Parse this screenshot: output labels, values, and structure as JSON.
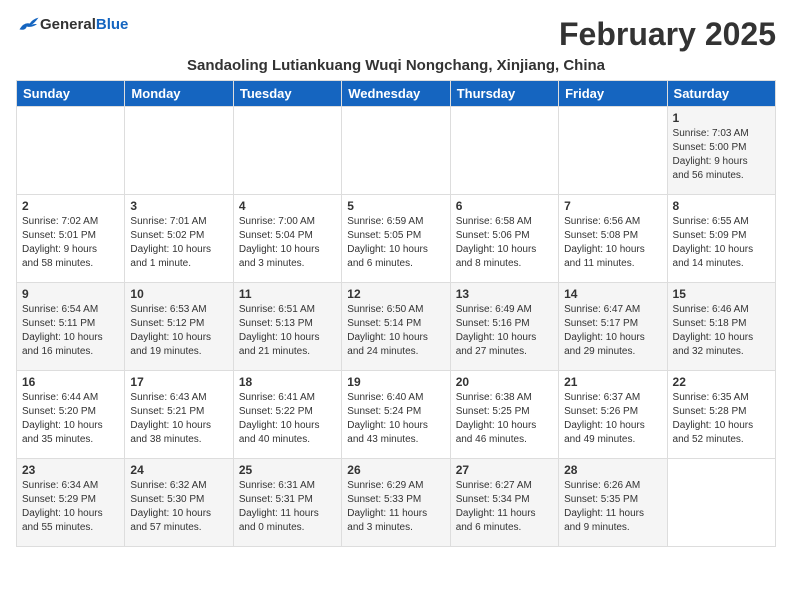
{
  "logo": {
    "general": "General",
    "blue": "Blue"
  },
  "title": "February 2025",
  "location": "Sandaoling Lutiankuang Wuqi Nongchang, Xinjiang, China",
  "weekdays": [
    "Sunday",
    "Monday",
    "Tuesday",
    "Wednesday",
    "Thursday",
    "Friday",
    "Saturday"
  ],
  "weeks": [
    [
      {
        "day": "",
        "info": ""
      },
      {
        "day": "",
        "info": ""
      },
      {
        "day": "",
        "info": ""
      },
      {
        "day": "",
        "info": ""
      },
      {
        "day": "",
        "info": ""
      },
      {
        "day": "",
        "info": ""
      },
      {
        "day": "1",
        "info": "Sunrise: 7:03 AM\nSunset: 5:00 PM\nDaylight: 9 hours\nand 56 minutes."
      }
    ],
    [
      {
        "day": "2",
        "info": "Sunrise: 7:02 AM\nSunset: 5:01 PM\nDaylight: 9 hours\nand 58 minutes."
      },
      {
        "day": "3",
        "info": "Sunrise: 7:01 AM\nSunset: 5:02 PM\nDaylight: 10 hours\nand 1 minute."
      },
      {
        "day": "4",
        "info": "Sunrise: 7:00 AM\nSunset: 5:04 PM\nDaylight: 10 hours\nand 3 minutes."
      },
      {
        "day": "5",
        "info": "Sunrise: 6:59 AM\nSunset: 5:05 PM\nDaylight: 10 hours\nand 6 minutes."
      },
      {
        "day": "6",
        "info": "Sunrise: 6:58 AM\nSunset: 5:06 PM\nDaylight: 10 hours\nand 8 minutes."
      },
      {
        "day": "7",
        "info": "Sunrise: 6:56 AM\nSunset: 5:08 PM\nDaylight: 10 hours\nand 11 minutes."
      },
      {
        "day": "8",
        "info": "Sunrise: 6:55 AM\nSunset: 5:09 PM\nDaylight: 10 hours\nand 14 minutes."
      }
    ],
    [
      {
        "day": "9",
        "info": "Sunrise: 6:54 AM\nSunset: 5:11 PM\nDaylight: 10 hours\nand 16 minutes."
      },
      {
        "day": "10",
        "info": "Sunrise: 6:53 AM\nSunset: 5:12 PM\nDaylight: 10 hours\nand 19 minutes."
      },
      {
        "day": "11",
        "info": "Sunrise: 6:51 AM\nSunset: 5:13 PM\nDaylight: 10 hours\nand 21 minutes."
      },
      {
        "day": "12",
        "info": "Sunrise: 6:50 AM\nSunset: 5:14 PM\nDaylight: 10 hours\nand 24 minutes."
      },
      {
        "day": "13",
        "info": "Sunrise: 6:49 AM\nSunset: 5:16 PM\nDaylight: 10 hours\nand 27 minutes."
      },
      {
        "day": "14",
        "info": "Sunrise: 6:47 AM\nSunset: 5:17 PM\nDaylight: 10 hours\nand 29 minutes."
      },
      {
        "day": "15",
        "info": "Sunrise: 6:46 AM\nSunset: 5:18 PM\nDaylight: 10 hours\nand 32 minutes."
      }
    ],
    [
      {
        "day": "16",
        "info": "Sunrise: 6:44 AM\nSunset: 5:20 PM\nDaylight: 10 hours\nand 35 minutes."
      },
      {
        "day": "17",
        "info": "Sunrise: 6:43 AM\nSunset: 5:21 PM\nDaylight: 10 hours\nand 38 minutes."
      },
      {
        "day": "18",
        "info": "Sunrise: 6:41 AM\nSunset: 5:22 PM\nDaylight: 10 hours\nand 40 minutes."
      },
      {
        "day": "19",
        "info": "Sunrise: 6:40 AM\nSunset: 5:24 PM\nDaylight: 10 hours\nand 43 minutes."
      },
      {
        "day": "20",
        "info": "Sunrise: 6:38 AM\nSunset: 5:25 PM\nDaylight: 10 hours\nand 46 minutes."
      },
      {
        "day": "21",
        "info": "Sunrise: 6:37 AM\nSunset: 5:26 PM\nDaylight: 10 hours\nand 49 minutes."
      },
      {
        "day": "22",
        "info": "Sunrise: 6:35 AM\nSunset: 5:28 PM\nDaylight: 10 hours\nand 52 minutes."
      }
    ],
    [
      {
        "day": "23",
        "info": "Sunrise: 6:34 AM\nSunset: 5:29 PM\nDaylight: 10 hours\nand 55 minutes."
      },
      {
        "day": "24",
        "info": "Sunrise: 6:32 AM\nSunset: 5:30 PM\nDaylight: 10 hours\nand 57 minutes."
      },
      {
        "day": "25",
        "info": "Sunrise: 6:31 AM\nSunset: 5:31 PM\nDaylight: 11 hours\nand 0 minutes."
      },
      {
        "day": "26",
        "info": "Sunrise: 6:29 AM\nSunset: 5:33 PM\nDaylight: 11 hours\nand 3 minutes."
      },
      {
        "day": "27",
        "info": "Sunrise: 6:27 AM\nSunset: 5:34 PM\nDaylight: 11 hours\nand 6 minutes."
      },
      {
        "day": "28",
        "info": "Sunrise: 6:26 AM\nSunset: 5:35 PM\nDaylight: 11 hours\nand 9 minutes."
      },
      {
        "day": "",
        "info": ""
      }
    ]
  ]
}
